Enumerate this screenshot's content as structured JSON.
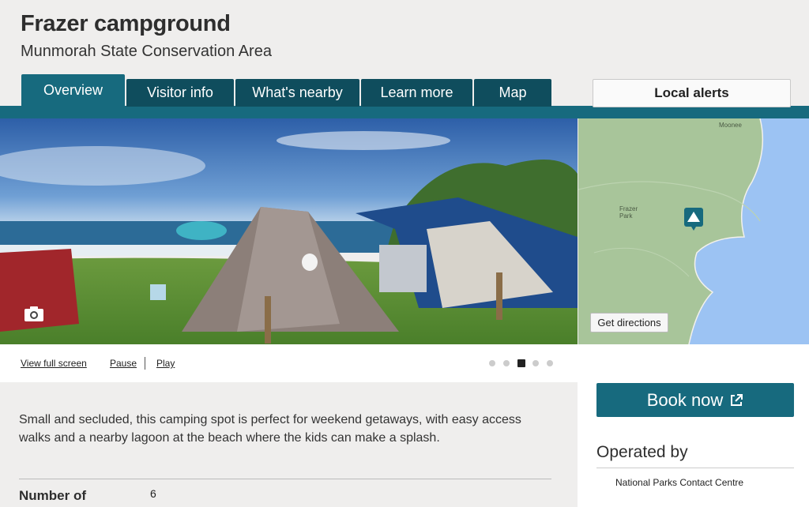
{
  "header": {
    "title": "Frazer campground",
    "subtitle": "Munmorah State Conservation Area"
  },
  "tabs": [
    {
      "label": "Overview",
      "active": true
    },
    {
      "label": "Visitor info",
      "active": false
    },
    {
      "label": "What's nearby",
      "active": false
    },
    {
      "label": "Learn more",
      "active": false
    },
    {
      "label": "Map",
      "active": false
    }
  ],
  "alerts": {
    "label": "Local alerts"
  },
  "map": {
    "directions_label": "Get directions",
    "place_labels": [
      "Moonee",
      "Frazer Park"
    ]
  },
  "gallery": {
    "fullscreen_label": "View full screen",
    "pause_label": "Pause",
    "play_label": "Play",
    "slide_count": 5,
    "active_slide": 3
  },
  "booking": {
    "label": "Book now",
    "icon": "external-link-icon"
  },
  "operated_by": {
    "title": "Operated by",
    "operator": "National Parks Contact Centre"
  },
  "intro_text": "Small and secluded, this camping spot is perfect for weekend getaways, with easy access walks and a nearby lagoon at the beach where the kids can make a splash.",
  "details": [
    {
      "label": "Number of",
      "value": "6"
    }
  ],
  "colors": {
    "accent": "#176a7e",
    "tab_dark": "#0f4d5d",
    "background": "#efeeed"
  }
}
